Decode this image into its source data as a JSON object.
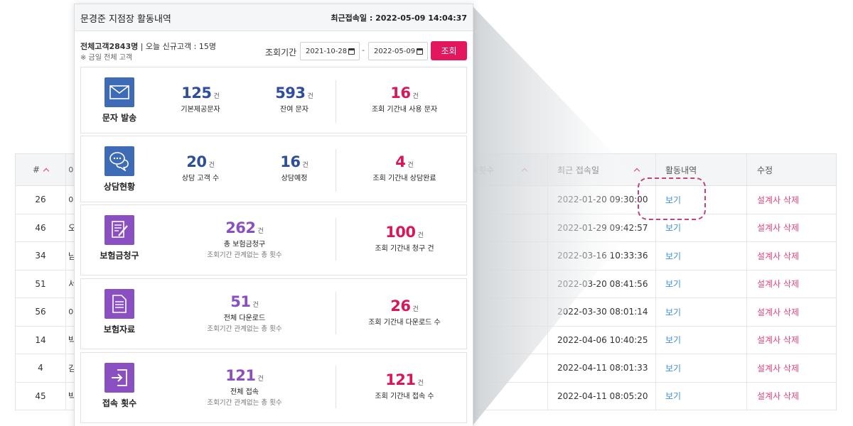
{
  "table": {
    "headers": [
      "#",
      "이",
      "속횟수",
      "최근 접속일",
      "활동내역",
      "수정"
    ],
    "rows": [
      {
        "no": "26",
        "name": "이",
        "date": "2022-01-20 09:30:00",
        "view": "보기",
        "action": "설계사 삭제"
      },
      {
        "no": "46",
        "name": "오",
        "date": "2022-01-29 09:42:57",
        "view": "보기",
        "action": "설계사 삭제"
      },
      {
        "no": "34",
        "name": "남",
        "date": "2022-03-16 10:33:36",
        "view": "보기",
        "action": "설계사 삭제"
      },
      {
        "no": "51",
        "name": "서",
        "date": "2022-03-20 08:41:56",
        "view": "보기",
        "action": "설계사 삭제"
      },
      {
        "no": "56",
        "name": "이",
        "date": "2022-03-30 08:01:14",
        "view": "보기",
        "action": "설계사 삭제"
      },
      {
        "no": "14",
        "name": "박",
        "date": "2022-04-06 10:40:25",
        "view": "보기",
        "action": "설계사 삭제"
      },
      {
        "no": "4",
        "name": "김",
        "date": "2022-04-11 08:01:33",
        "view": "보기",
        "action": "설계사 삭제"
      },
      {
        "no": "45",
        "name": "박",
        "date": "2022-04-11 08:05:20",
        "view": "보기",
        "action": "설계사 삭제"
      }
    ]
  },
  "popup": {
    "title": "문경준 지점장 활동내역",
    "last_login": "최근접속일 : 2022-05-09 14:04:37",
    "summary_total": "전체고객2843명",
    "summary_rest": " | 오늘 신규고객 : 15명",
    "summary_note": "※ 금일 전체 고객",
    "period_label": "조회기간",
    "date_from": "2021-10-28",
    "date_to": "2022-05-09",
    "date_sep": "-",
    "search_label": "조회"
  },
  "cards": {
    "sms": {
      "label": "문자 발송",
      "s1": {
        "num": "125",
        "unit": "건",
        "cap": "기본제공문자"
      },
      "s2": {
        "num": "593",
        "unit": "건",
        "cap": "잔여 문자"
      },
      "s3": {
        "num": "16",
        "unit": "건",
        "cap": "조회 기간내 사용 문자"
      }
    },
    "consult": {
      "label": "상담현황",
      "s1": {
        "num": "20",
        "unit": "건",
        "cap": "상담 고객 수"
      },
      "s2": {
        "num": "16",
        "unit": "건",
        "cap": "상담예정"
      },
      "s3": {
        "num": "4",
        "unit": "건",
        "cap": "조회 기간내 상담완료"
      }
    },
    "claim": {
      "label": "보험금청구",
      "s1": {
        "num": "262",
        "unit": "건",
        "cap": "총 보험금청구",
        "cap2": "조회기간 관계없는 총 횟수"
      },
      "s2": {
        "num": "100",
        "unit": "건",
        "cap": "조회 기간내 청구 건"
      }
    },
    "docs": {
      "label": "보험자료",
      "s1": {
        "num": "51",
        "unit": "건",
        "cap": "전체 다운로드",
        "cap2": "조회기간 관계없는 총 횟수"
      },
      "s2": {
        "num": "26",
        "unit": "건",
        "cap": "조회 기간내 다운로드 수"
      }
    },
    "access": {
      "label": "접속 횟수",
      "s1": {
        "num": "121",
        "unit": "건",
        "cap": "전체 접속",
        "cap2": "조회기간 관계없는 총 횟수"
      },
      "s2": {
        "num": "121",
        "unit": "건",
        "cap": "조회 기간내 접속 수"
      }
    }
  },
  "icons": {
    "sms": "envelope-icon",
    "consult": "chat-bubbles-icon",
    "claim": "claim-form-icon",
    "docs": "document-icon",
    "access": "login-icon"
  },
  "colors": {
    "accent": "#e3175d",
    "blue_num": "#2e4d9a",
    "red_num": "#d8175a",
    "purple_num": "#8a4fc1",
    "link_view": "#3b8fd9",
    "link_delete": "#e0457a",
    "highlight": "#c2407e"
  }
}
